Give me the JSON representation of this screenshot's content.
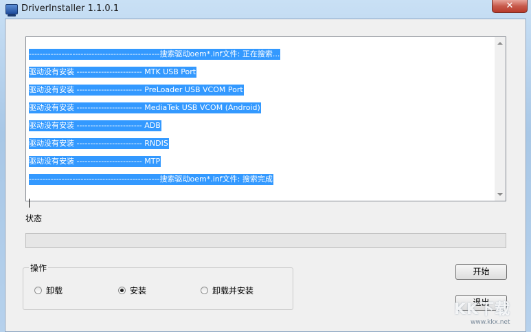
{
  "window": {
    "title": "DriverInstaller 1.1.0.1",
    "close_glyph": "✕"
  },
  "log": {
    "lines": [
      "------------------------------------------------搜索驱动oem*.inf文件: 正在搜索...",
      "驱动没有安装 ------------------------ MTK USB Port",
      "驱动没有安装 ------------------------ PreLoader USB VCOM Port",
      "驱动没有安装 ------------------------ MediaTek USB VCOM (Android)",
      "驱动没有安装 ------------------------ ADB",
      "驱动没有安装 ------------------------ RNDIS",
      "驱动没有安装 ------------------------ MTP",
      "------------------------------------------------搜索驱动oem*.inf文件: 搜索完成"
    ],
    "selection_color": "#3399ff"
  },
  "status": {
    "label": "状态",
    "progress": 0
  },
  "operation": {
    "legend": "操作",
    "options": [
      "卸载",
      "安装",
      "卸载并安装"
    ],
    "selected": "安装"
  },
  "buttons": {
    "start": "开始",
    "exit": "退出"
  },
  "watermark": {
    "logo": "KK下载",
    "url": "www.kkx.net"
  }
}
